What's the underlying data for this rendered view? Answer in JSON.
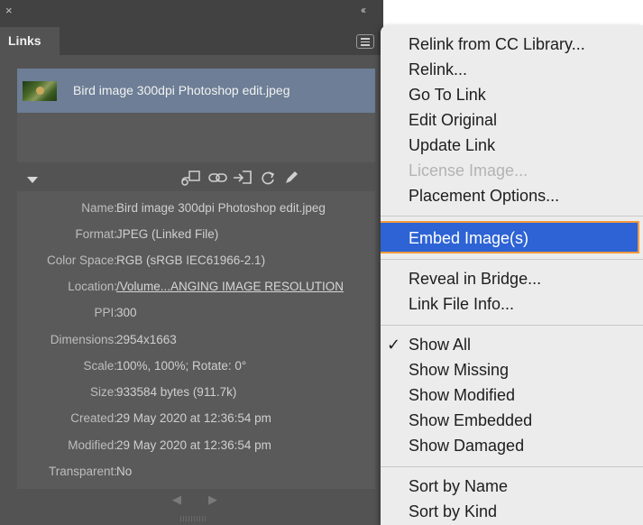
{
  "panel": {
    "close_glyph": "×",
    "collapse_glyph": "‹‹",
    "tab_label": "Links",
    "menu_icon": "hamburger-icon",
    "links": [
      {
        "name": "Bird image 300dpi Photoshop edit.jpeg",
        "selected": true
      }
    ],
    "toolbar_icons": [
      "cc-library-relink-icon",
      "relink-icon",
      "go-to-link-icon",
      "update-link-icon",
      "edit-original-icon"
    ],
    "info": [
      {
        "label": "Name:",
        "value": "Bird image 300dpi Photoshop edit.jpeg"
      },
      {
        "label": "Format:",
        "value": "JPEG (Linked File)"
      },
      {
        "label": "Color Space:",
        "value": "RGB (sRGB IEC61966-2.1)"
      },
      {
        "label": "Location:",
        "value": "/Volume...ANGING IMAGE RESOLUTION"
      },
      {
        "label": "PPI:",
        "value": "300"
      },
      {
        "label": "Dimensions:",
        "value": "2954x1663"
      },
      {
        "label": "Scale:",
        "value": "100%, 100%; Rotate: 0°"
      },
      {
        "label": "Size:",
        "value": "933584 bytes (911.7k)"
      },
      {
        "label": "Created:",
        "value": "29 May 2020 at 12:36:54 pm"
      },
      {
        "label": "Modified:",
        "value": "29 May 2020 at 12:36:54 pm"
      },
      {
        "label": "Transparent:",
        "value": "No"
      }
    ],
    "nav_prev": "◀",
    "nav_next": "▶"
  },
  "menu": {
    "items": [
      {
        "label": "Relink from CC Library...",
        "disabled": false
      },
      {
        "label": "Relink...",
        "disabled": false
      },
      {
        "label": "Go To Link",
        "disabled": false
      },
      {
        "label": "Edit Original",
        "disabled": false
      },
      {
        "label": "Update Link",
        "disabled": false
      },
      {
        "label": "License Image...",
        "disabled": true
      },
      {
        "label": "Placement Options...",
        "disabled": false
      },
      {
        "label": "Embed Image(s)",
        "highlighted": true
      },
      {
        "label": "Reveal in Bridge...",
        "disabled": false
      },
      {
        "label": "Link File Info...",
        "disabled": false
      },
      {
        "label": "Show All",
        "checked": true
      },
      {
        "label": "Show Missing",
        "disabled": false
      },
      {
        "label": "Show Modified",
        "disabled": false
      },
      {
        "label": "Show Embedded",
        "disabled": false
      },
      {
        "label": "Show Damaged",
        "disabled": false
      },
      {
        "label": "Sort by Name",
        "disabled": false
      },
      {
        "label": "Sort by Kind",
        "disabled": false
      }
    ],
    "check_glyph": "✓"
  },
  "colors": {
    "panel_bg": "#535353",
    "selected_row": "#6d7e96",
    "menu_highlight": "#2d63d4",
    "highlight_outline": "#f09a3e"
  }
}
